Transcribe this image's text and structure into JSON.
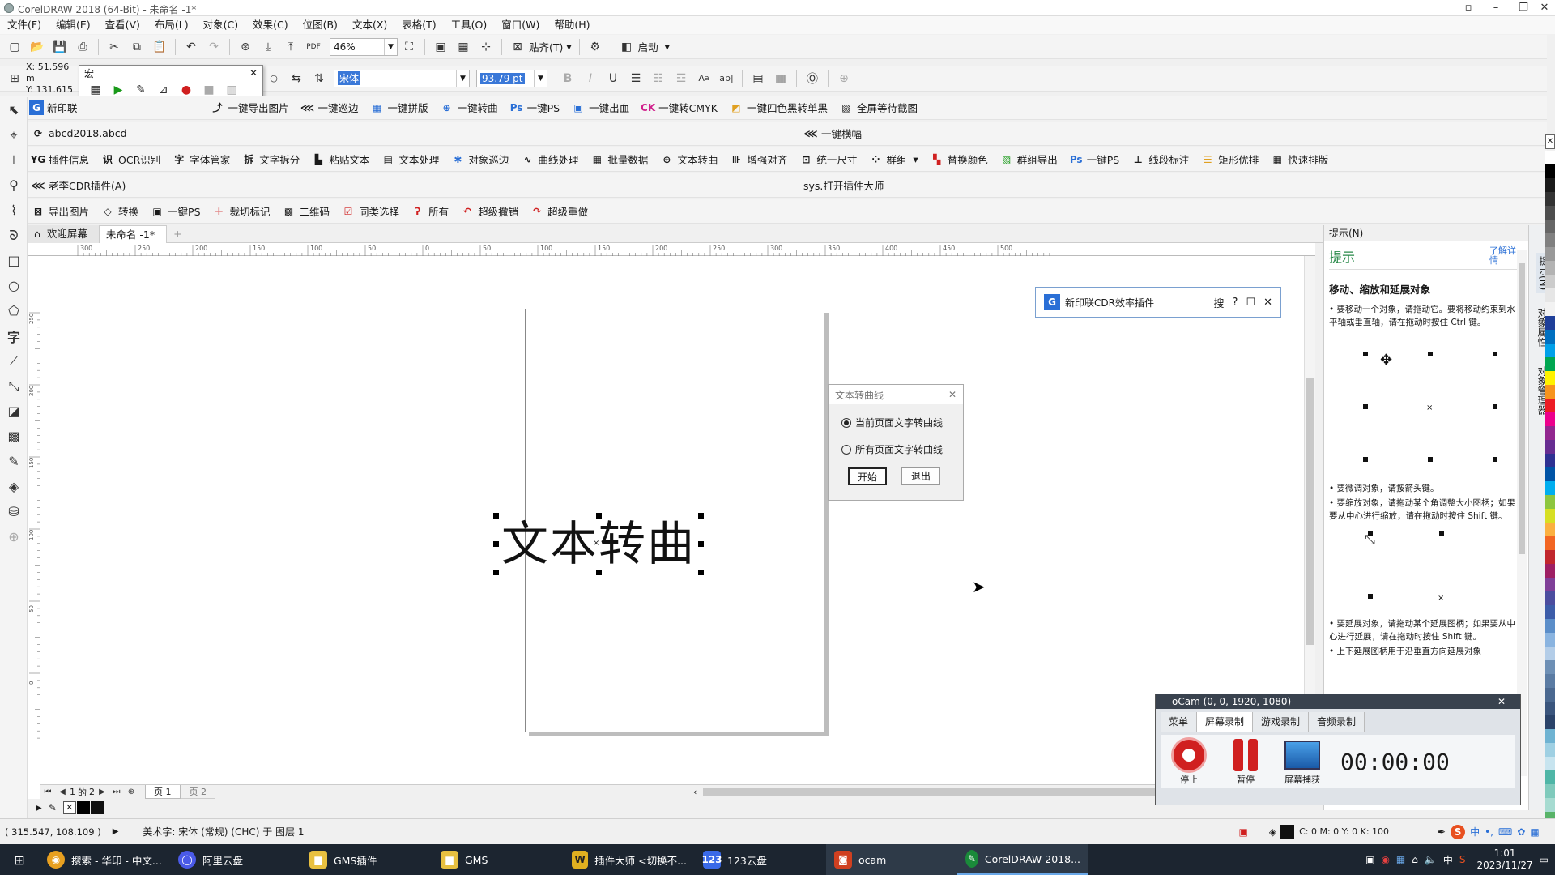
{
  "window": {
    "title": "CorelDRAW 2018 (64-Bit) - 未命名 -1*"
  },
  "menu": [
    "文件(F)",
    "编辑(E)",
    "查看(V)",
    "布局(L)",
    "对象(C)",
    "效果(C)",
    "位图(B)",
    "文本(X)",
    "表格(T)",
    "工具(O)",
    "窗口(W)",
    "帮助(H)"
  ],
  "standard_toolbar": {
    "zoom": "46%",
    "snap": "贴齐(T)",
    "launch": "启动"
  },
  "property_bar": {
    "x": "51.596 m",
    "y": "131.615",
    "macro_title": "宏",
    "font_name": "宋体",
    "font_size": "93.79 pt"
  },
  "plugin_row1": [
    "新印联",
    "一键导出图片",
    "一键巡边",
    "一键拼版",
    "一键转曲",
    "一键PS",
    "一键出血",
    "一键转CMYK",
    "一键四色黑转单黑",
    "全屏等待截图"
  ],
  "plugin_row2": {
    "left": "abcd2018.abcd",
    "right": "一键横幅"
  },
  "plugin_row3": [
    "插件信息",
    "OCR识别",
    "字体管家",
    "文字拆分",
    "粘贴文本",
    "文本处理",
    "对象巡边",
    "曲线处理",
    "批量数据",
    "文本转曲",
    "增强对齐",
    "统一尺寸",
    "群组",
    "替换颜色",
    "群组导出",
    "一键PS",
    "线段标注",
    "矩形优排",
    "快速排版"
  ],
  "plugin_row4": {
    "left": "老李CDR插件(A)",
    "right": "sys.打开插件大师"
  },
  "plugin_row5": [
    "导出图片",
    "转换",
    "一键PS",
    "裁切标记",
    "二维码",
    "同类选择",
    "所有",
    "超级撤销",
    "超级重做"
  ],
  "doc_tabs": {
    "welcome": "欢迎屏幕",
    "doc": "未命名 -1*",
    "add": "+"
  },
  "ruler_h": [
    "300",
    "250",
    "200",
    "150",
    "100",
    "50",
    "0",
    "50",
    "100",
    "150",
    "200",
    "250",
    "300",
    "350",
    "400",
    "450",
    "500"
  ],
  "ruler_v": [
    "250",
    "200",
    "150",
    "100",
    "50",
    "0"
  ],
  "canvas_text": "文本转曲",
  "dialog_text_to_curve": {
    "title": "文本转曲线",
    "option1": "当前页面文字转曲线",
    "option2": "所有页面文字转曲线",
    "start": "开始",
    "exit": "退出"
  },
  "plugin_floating": {
    "title": "新印联CDR效率插件",
    "search": "搜",
    "help": "?"
  },
  "hints": {
    "panel_title": "提示(N)",
    "heading": "提示",
    "learn_more": "了解详情",
    "topic": "移动、缩放和延展对象",
    "p1": "要移动一个对象，请拖动它。要将移动约束到水平轴或垂直轴，请在拖动时按住 Ctrl 键。",
    "p2": "要微调对象，请按箭头键。",
    "p3": "要缩放对象，请拖动某个角调整大小图柄；如果要从中心进行缩放，请在拖动时按住 Shift 键。",
    "p4": "要延展对象，请拖动某个延展图柄；如果要从中心进行延展，请在拖动时按住 Shift 键。",
    "p5": "上下延展图柄用于沿垂直方向延展对象"
  },
  "side_tabs": [
    "提示(N)",
    "对象属性",
    "对象管理器"
  ],
  "palette_colors": [
    "#ffffff",
    "#000000",
    "#1a1a1a",
    "#333333",
    "#4d4d4d",
    "#666666",
    "#808080",
    "#999999",
    "#b3b3b3",
    "#cccccc",
    "#e6e6e6",
    "#f2f2f2",
    "#1f3f99",
    "#0070c0",
    "#00a0e9",
    "#00a651",
    "#fff200",
    "#f7941d",
    "#ed1c24",
    "#ec008c",
    "#92278f",
    "#662d91",
    "#2e3192",
    "#0054a6",
    "#00aeef",
    "#8dc63f",
    "#d7df23",
    "#fbb040",
    "#f26522",
    "#c1272d",
    "#9e1f63",
    "#7f3f98",
    "#4b4d9f",
    "#3c5da9",
    "#5b8ec9",
    "#8ab4e0",
    "#b3cde8",
    "#6d8fb5",
    "#5a7ba3",
    "#4a6890",
    "#3a557d",
    "#2a436a",
    "#6fb3d2",
    "#9fd0e3",
    "#c7e4ef",
    "#4fb6a7",
    "#7fcabc",
    "#a6dbd1",
    "#58b368",
    "#87c78f"
  ],
  "page_nav": {
    "current": "1",
    "of": "2",
    "page1": "页 1",
    "page2": "页 2"
  },
  "status": {
    "coords": "( 315.547, 108.109 )",
    "info": "美术字: 宋体 (常规) (CHC) 于 图层 1",
    "fill": "C: 0 M: 0 Y: 0 K: 100"
  },
  "ocam": {
    "title": "oCam (0, 0, 1920, 1080)",
    "tabs": [
      "菜单",
      "屏幕录制",
      "游戏录制",
      "音频录制"
    ],
    "stop": "停止",
    "pause": "暂停",
    "capture": "屏幕捕获",
    "time": "00:00:00"
  },
  "taskbar": {
    "items": [
      "搜索 - 华印 - 中文...",
      "阿里云盘",
      "GMS插件",
      "GMS",
      "插件大师 <切换不...",
      "123云盘",
      "ocam",
      "CorelDRAW 2018..."
    ],
    "time": "1:01",
    "date": "2023/11/27",
    "ime": "中"
  },
  "colors": {
    "accent": "#0078d7",
    "taskbar": "#1c2530",
    "record": "#d02020"
  }
}
